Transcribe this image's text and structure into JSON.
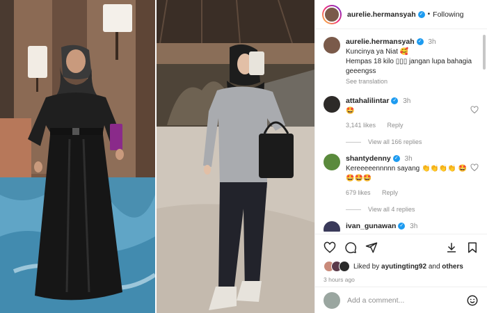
{
  "header": {
    "username": "aurelie.hermansyah",
    "follow_status": "Following",
    "dot": "•"
  },
  "caption": {
    "username": "aurelie.hermansyah",
    "time": "3h",
    "line1": "Kuncinya ya Niat 🥰",
    "line2": "Hempas 18 kilo ▯▯▯ jangan lupa bahagia geeengss",
    "see_translation": "See translation"
  },
  "comments": [
    {
      "username": "attahalilintar",
      "time": "3h",
      "text": "🤩",
      "likes": "3,141 likes",
      "reply": "Reply",
      "view_replies": "View all 166 replies",
      "avatar_color": "#2d2a28"
    },
    {
      "username": "shantydenny",
      "time": "3h",
      "text": "Kereeeeennnnn sayang 👏👏👏👏 🤩🤩🤩🤩",
      "likes": "679 likes",
      "reply": "Reply",
      "view_replies": "View all 4 replies",
      "avatar_color": "#5a8a3c"
    },
    {
      "username": "ivan_gunawan",
      "time": "3h",
      "avatar_color": "#3a3a5a"
    }
  ],
  "likes": {
    "prefix": "Liked by",
    "user": "ayutingting92",
    "and": "and",
    "others": "others"
  },
  "post_time": "3 hours ago",
  "add_comment": {
    "placeholder": "Add a comment..."
  },
  "colors": {
    "verified": "#1d9bf0",
    "secondary_text": "#8e8e8e",
    "border": "#efefef"
  },
  "icons": [
    "heart-icon",
    "comment-icon",
    "share-icon",
    "download-icon",
    "bookmark-icon",
    "emoji-icon",
    "verified-icon"
  ]
}
